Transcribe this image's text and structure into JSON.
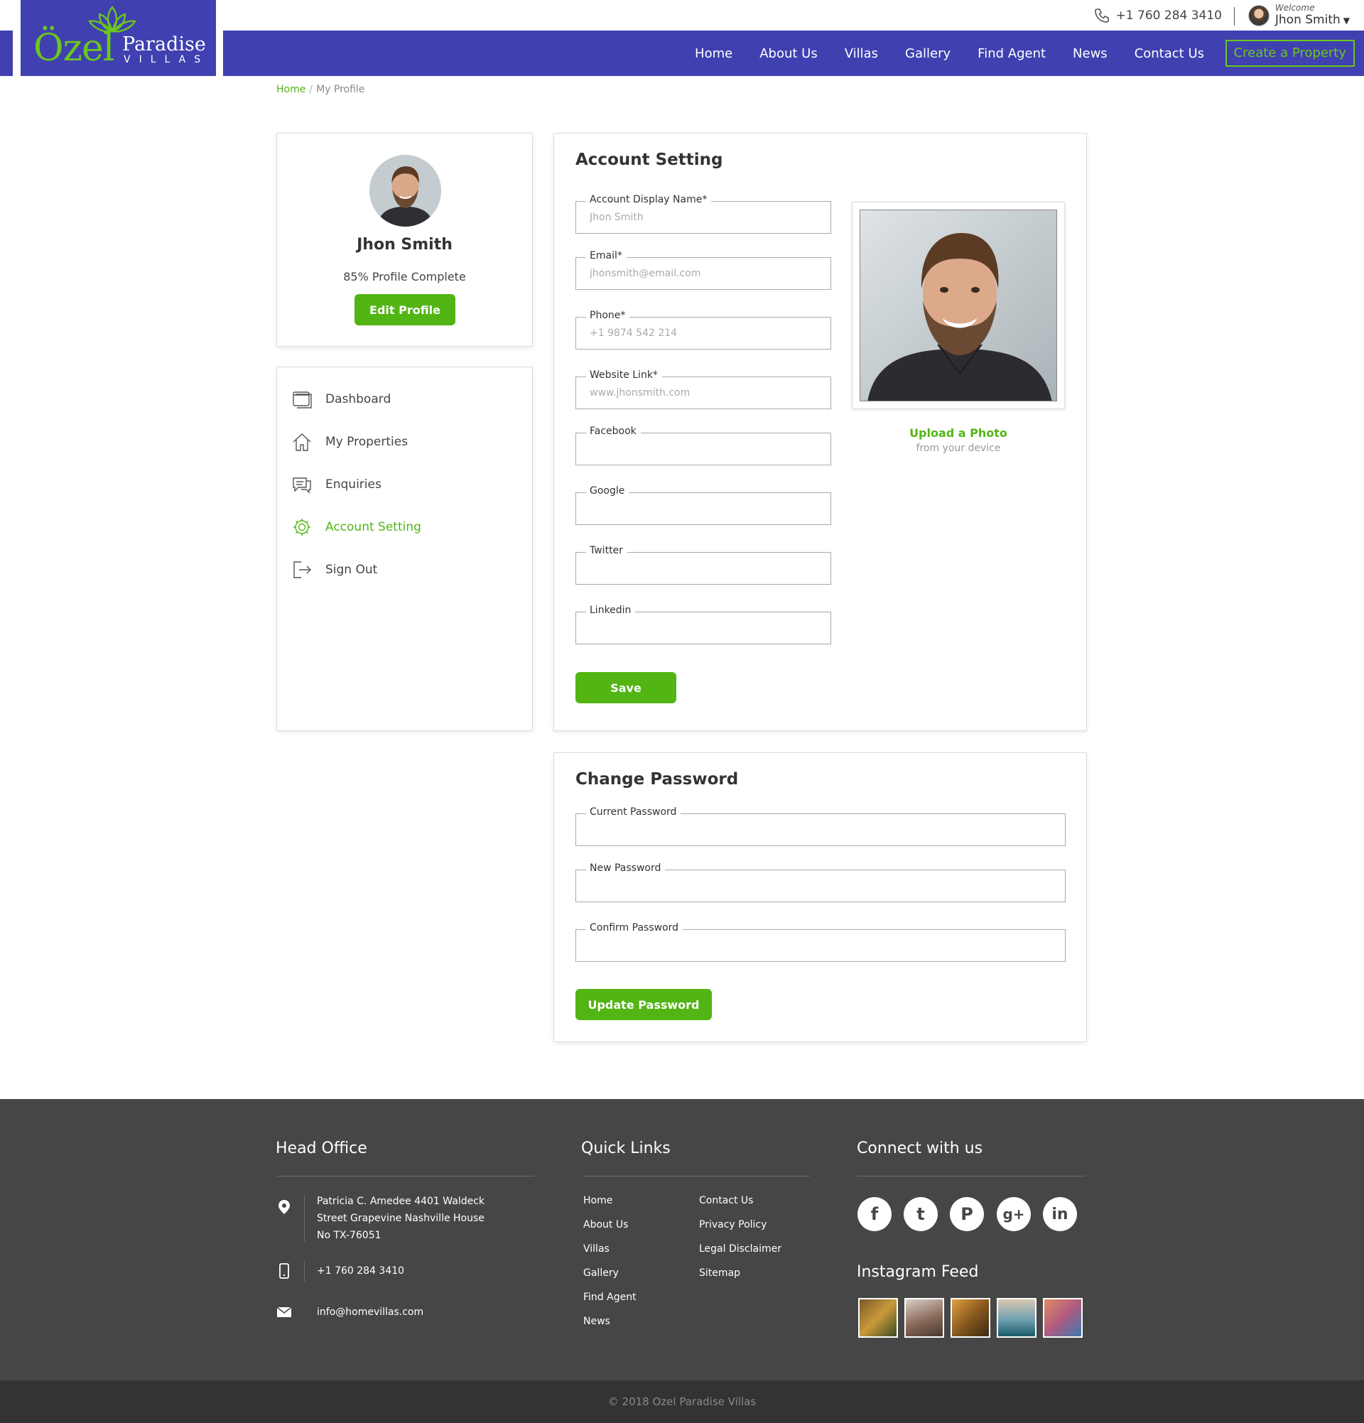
{
  "header": {
    "phone": "+1 760 284 3410",
    "welcome": "Welcome",
    "user_name": "Jhon Smith",
    "logo_ozel": "Özel",
    "logo_paradise": "Paradise",
    "logo_villas": "VILLAS",
    "nav": [
      "Home",
      "About Us",
      "Villas",
      "Gallery",
      "Find Agent",
      "News",
      "Contact Us"
    ],
    "create_property": "Create a Property"
  },
  "breadcrumb": {
    "home": "Home",
    "separator": "/",
    "current": "My Profile"
  },
  "profile": {
    "name": "Jhon Smith",
    "complete": "85% Profile Complete",
    "edit_button": "Edit Profile"
  },
  "menu": {
    "items": [
      {
        "label": "Dashboard",
        "icon": "dashboard-icon"
      },
      {
        "label": "My Properties",
        "icon": "home-icon"
      },
      {
        "label": "Enquiries",
        "icon": "chat-icon"
      },
      {
        "label": "Account Setting",
        "icon": "gear-icon",
        "active": true
      },
      {
        "label": "Sign Out",
        "icon": "sign-out-icon"
      }
    ]
  },
  "account": {
    "title": "Account Setting",
    "fields": [
      {
        "label": "Account Display Name*",
        "placeholder": "Jhon Smith"
      },
      {
        "label": "Email*",
        "placeholder": "jhonsmith@email.com"
      },
      {
        "label": "Phone*",
        "placeholder": "+1 9874 542 214"
      },
      {
        "label": "Website Link*",
        "placeholder": "www.jhonsmith.com"
      },
      {
        "label": "Facebook",
        "placeholder": ""
      },
      {
        "label": "Google",
        "placeholder": ""
      },
      {
        "label": "Twitter",
        "placeholder": ""
      },
      {
        "label": "Linkedin",
        "placeholder": ""
      }
    ],
    "upload_label": "Upload a Photo",
    "upload_sub": "from your device",
    "save_button": "Save"
  },
  "password": {
    "title": "Change Password",
    "fields": [
      {
        "label": "Current Password"
      },
      {
        "label": "New Password"
      },
      {
        "label": "Confirm Password"
      }
    ],
    "update_button": "Update Password"
  },
  "footer": {
    "head_office_title": "Head Office",
    "address_lines": [
      "Patricia C. Amedee 4401 Waldeck",
      "Street Grapevine Nashville House",
      "No TX-76051"
    ],
    "phone": "+1 760 284 3410",
    "email": "info@homevillas.com",
    "quick_links_title": "Quick Links",
    "quick_links_col1": [
      "Home",
      "About Us",
      "Villas",
      "Gallery",
      "Find Agent",
      "News"
    ],
    "quick_links_col2": [
      "Contact Us",
      "Privacy Policy",
      "Legal Disclaimer",
      "Sitemap"
    ],
    "connect_title": "Connect with us",
    "social": [
      {
        "icon": "facebook-icon",
        "glyph": "f"
      },
      {
        "icon": "twitter-icon",
        "glyph": "t"
      },
      {
        "icon": "pinterest-icon",
        "glyph": "P"
      },
      {
        "icon": "google-plus-icon",
        "glyph": "g+"
      },
      {
        "icon": "linkedin-icon",
        "glyph": "in"
      }
    ],
    "instagram_title": "Instagram Feed",
    "copyright": "© 2018 Ozel Paradise Villas"
  },
  "colors": {
    "brand_blue": "#4040b0",
    "brand_green": "#52b514",
    "footer_bg": "#464646",
    "footer_bottom_bg": "#333333"
  }
}
